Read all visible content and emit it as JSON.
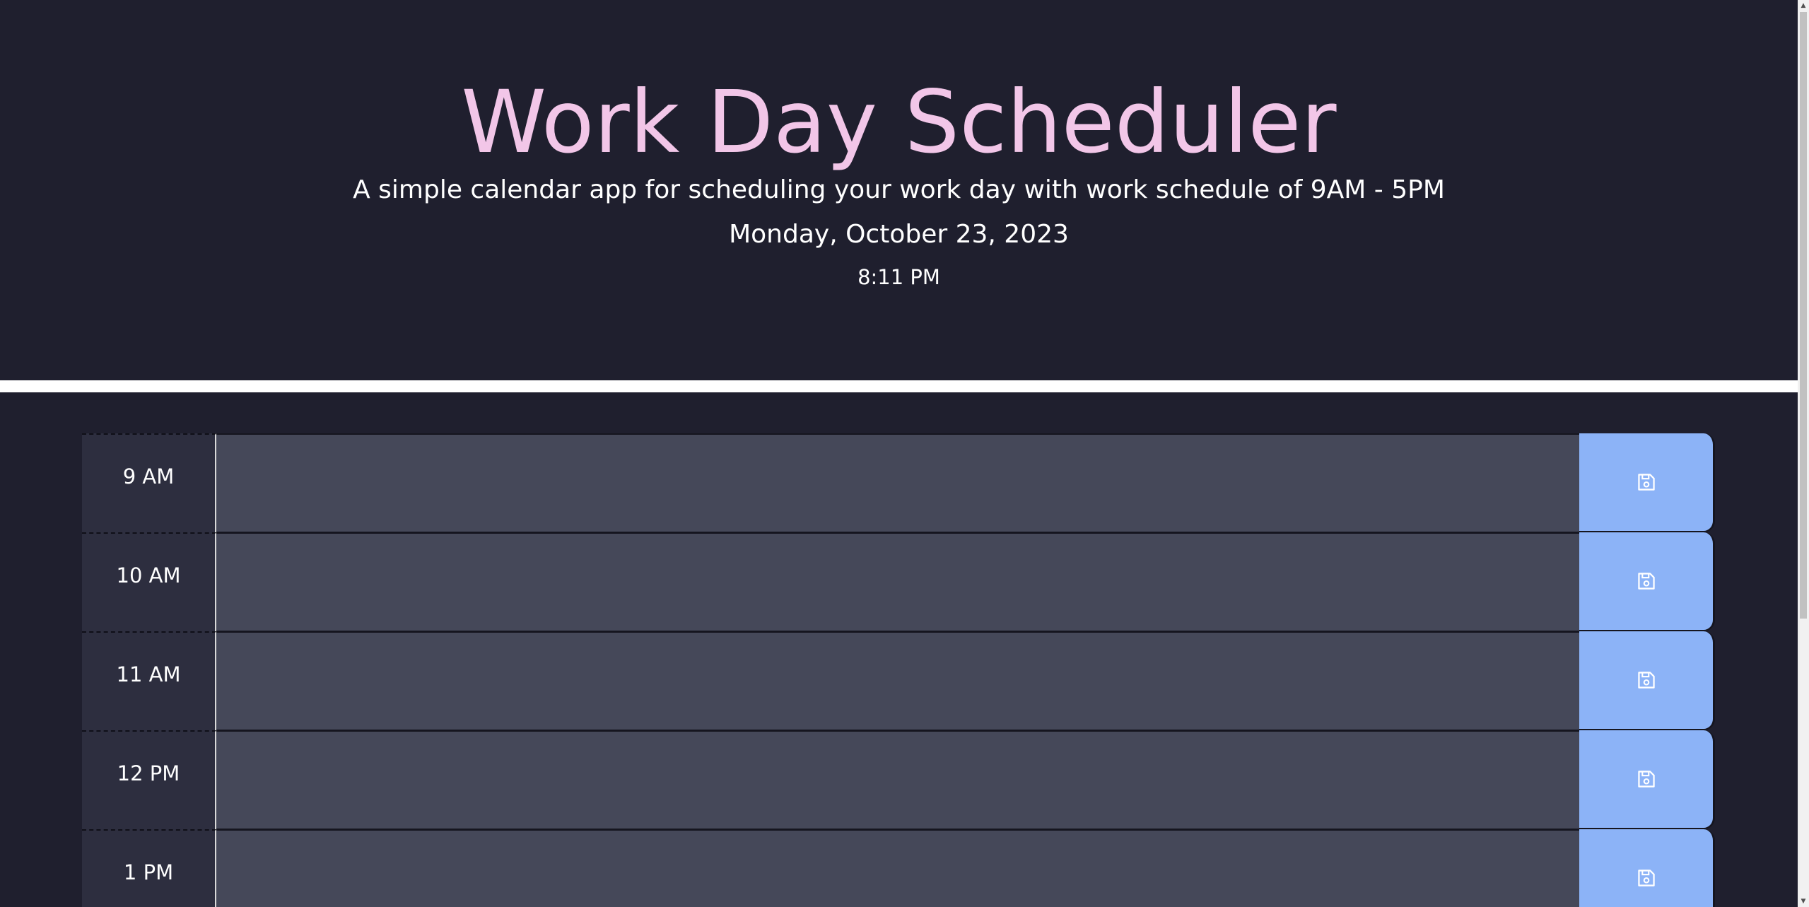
{
  "header": {
    "title": "Work Day Scheduler",
    "subtitle": "A simple calendar app for scheduling your work day with work schedule of 9AM - 5PM",
    "current_date": "Monday, October 23, 2023",
    "current_time": "8:11 PM"
  },
  "time_blocks": [
    {
      "hour": "9 AM",
      "description": ""
    },
    {
      "hour": "10 AM",
      "description": ""
    },
    {
      "hour": "11 AM",
      "description": ""
    },
    {
      "hour": "12 PM",
      "description": ""
    },
    {
      "hour": "1 PM",
      "description": ""
    }
  ],
  "save_button": {
    "icon": "save-icon"
  },
  "colors": {
    "background": "#1f1f2e",
    "title": "#f2c6e8",
    "hour_cell": "#2d2e3f",
    "description_past": "#454859",
    "save_button": "#8cb3f7"
  }
}
